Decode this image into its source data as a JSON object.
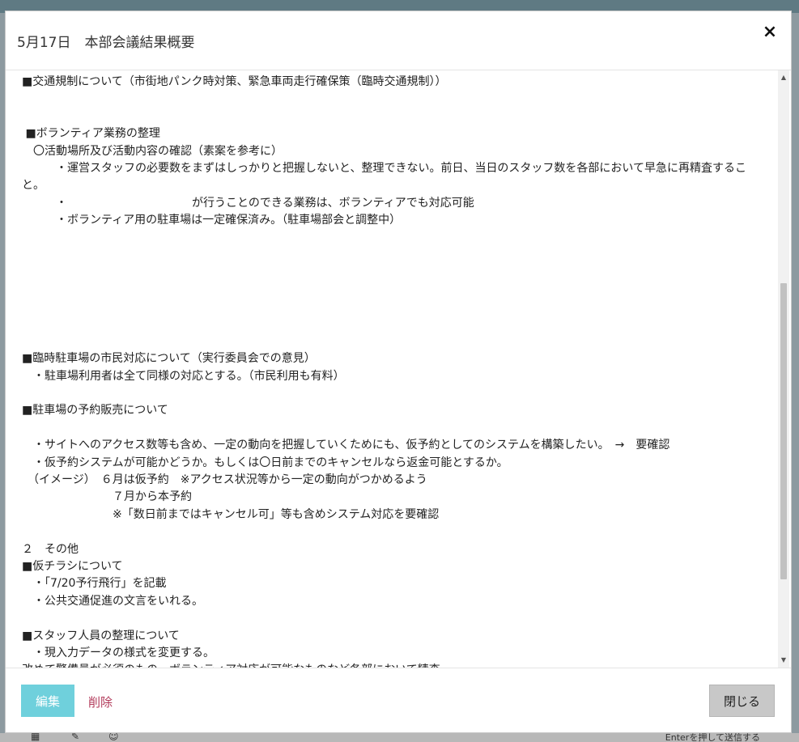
{
  "modal": {
    "title": "5月17日　本部会議結果概要",
    "close_icon": "×",
    "lines": [
      {
        "text": "■交通規制について（市街地パンク時対策、緊急車両走行確保策（臨時交通規制））",
        "wrap": false
      },
      {
        "text": "",
        "wrap": false
      },
      {
        "text": "",
        "wrap": false
      },
      {
        "text": " ■ボランティア業務の整理",
        "wrap": false
      },
      {
        "text": "　〇活動場所及び活動内容の確認（素案を参考に）",
        "wrap": false
      },
      {
        "text": "　　　・運営スタッフの必要数をまずはしっかりと把握しないと、整理できない。前日、当日のスタッフ数を各部において早急に再精査すること。",
        "wrap": true
      },
      {
        "text": "　　　・　　　　　　　　　　　が行うことのできる業務は、ボランティアでも対応可能",
        "wrap": false
      },
      {
        "text": "　　　・ボランティア用の駐車場は一定確保済み。（駐車場部会と調整中）",
        "wrap": false
      },
      {
        "text": "",
        "wrap": false
      },
      {
        "text": "",
        "wrap": false
      },
      {
        "text": "",
        "wrap": false
      },
      {
        "text": "",
        "wrap": false
      },
      {
        "text": "",
        "wrap": false
      },
      {
        "text": "",
        "wrap": false
      },
      {
        "text": "",
        "wrap": false
      },
      {
        "text": "■臨時駐車場の市民対応について（実行委員会での意見）",
        "wrap": false
      },
      {
        "text": "　・駐車場利用者は全て同様の対応とする。（市民利用も有料）",
        "wrap": false
      },
      {
        "text": "",
        "wrap": false
      },
      {
        "text": "■駐車場の予約販売について",
        "wrap": false
      },
      {
        "text": "",
        "wrap": false
      },
      {
        "text": "　・サイトへのアクセス数等も含め、一定の動向を把握していくためにも、仮予約としてのシステムを構築したい。　→　要確認",
        "wrap": false
      },
      {
        "text": "　・仮予約システムが可能かどうか。もしくは〇日前までのキャンセルなら返金可能とするか。",
        "wrap": false
      },
      {
        "text": "　（イメージ）　６月は仮予約　※アクセス状況等から一定の動向がつかめるよう",
        "wrap": false
      },
      {
        "text": "　　　　　　　　７月から本予約",
        "wrap": false
      },
      {
        "text": "　　　　　　　　※「数日前まではキャンセル可」等も含めシステム対応を要確認",
        "wrap": false
      },
      {
        "text": "",
        "wrap": false
      },
      {
        "text": "２　その他",
        "wrap": false
      },
      {
        "text": "■仮チラシについて",
        "wrap": false
      },
      {
        "text": "　・「7/20予行飛行」を記載",
        "wrap": false
      },
      {
        "text": "　・公共交通促進の文言をいれる。",
        "wrap": false
      },
      {
        "text": "",
        "wrap": false
      },
      {
        "text": "■スタッフ人員の整理について",
        "wrap": false
      },
      {
        "text": "　・現入力データの様式を変更する。",
        "wrap": false
      },
      {
        "text": "改めて警備員が必須のもの、ボランティア対応が可能なものなど各部において精査。",
        "wrap": false
      }
    ]
  },
  "scrollbar": {
    "up_icon": "▲",
    "down_icon": "▼"
  },
  "footer": {
    "edit_label": "編集",
    "delete_label": "削除",
    "close_label": "閉じる"
  },
  "background": {
    "hint_text": "Enterを押して送信する",
    "grid_icon": "▦",
    "pen_icon": "✎",
    "emoji_icon": "☺"
  }
}
